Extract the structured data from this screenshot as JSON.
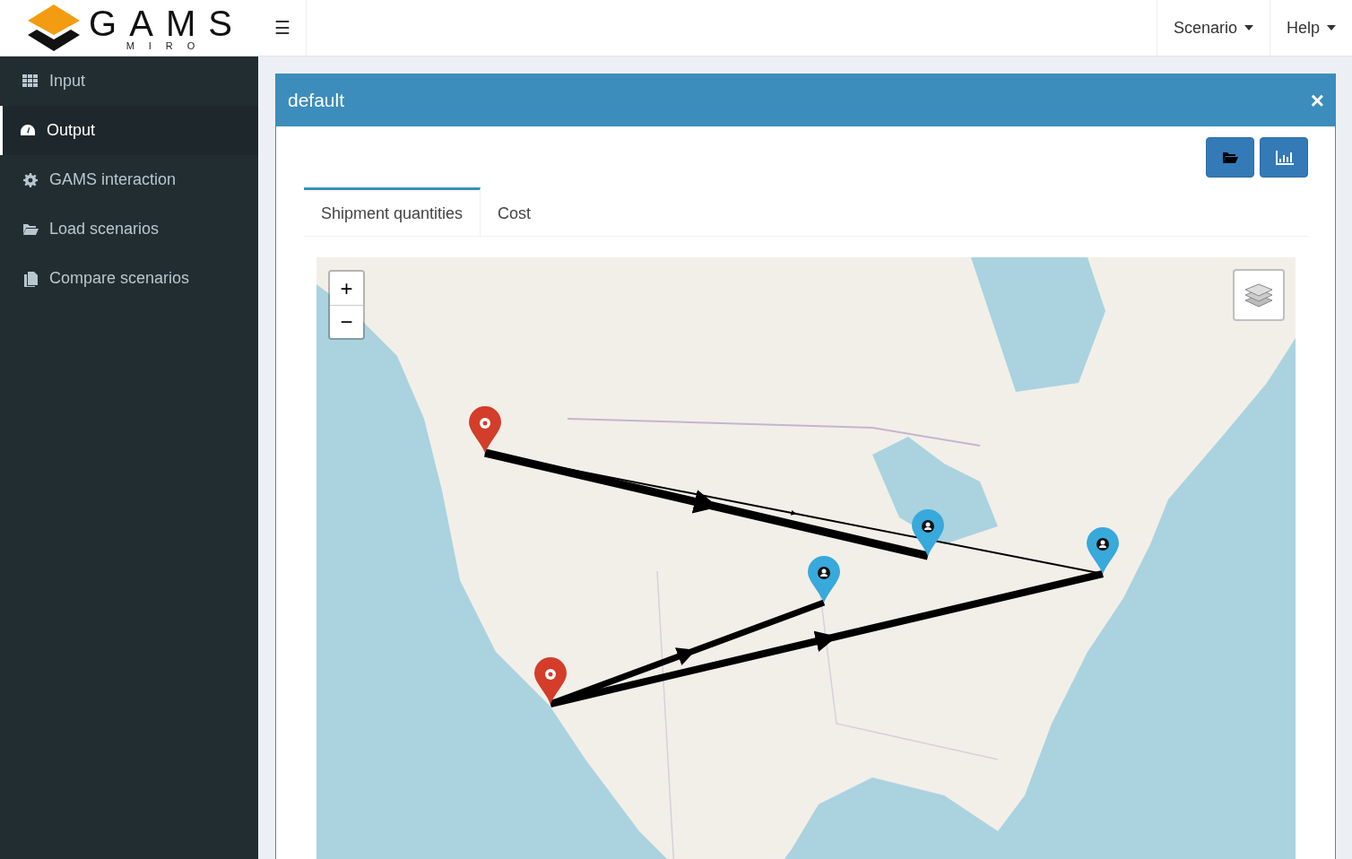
{
  "logo": {
    "name": "GAMS",
    "sub": "MIRO"
  },
  "toolbar": {
    "menu_toggle": "☰",
    "menus": [
      {
        "label": "Scenario"
      },
      {
        "label": "Help"
      }
    ]
  },
  "sidebar": {
    "items": [
      {
        "label": "Input",
        "selected": false
      },
      {
        "label": "Output",
        "selected": true
      },
      {
        "label": "GAMS interaction",
        "selected": false
      },
      {
        "label": "Load scenarios",
        "selected": false
      },
      {
        "label": "Compare scenarios",
        "selected": false
      }
    ]
  },
  "panel": {
    "title": "default",
    "close": "×",
    "tabs": [
      {
        "label": "Shipment quantities",
        "selected": true
      },
      {
        "label": "Cost",
        "selected": false
      }
    ],
    "map": {
      "zoom_in": "+",
      "zoom_out": "−",
      "markers": [
        {
          "kind": "plant",
          "color": "#d33d29"
        },
        {
          "kind": "plant",
          "color": "#d33d29"
        },
        {
          "kind": "market",
          "color": "#38a9db"
        },
        {
          "kind": "market",
          "color": "#38a9db"
        },
        {
          "kind": "market",
          "color": "#38a9db"
        }
      ]
    }
  }
}
